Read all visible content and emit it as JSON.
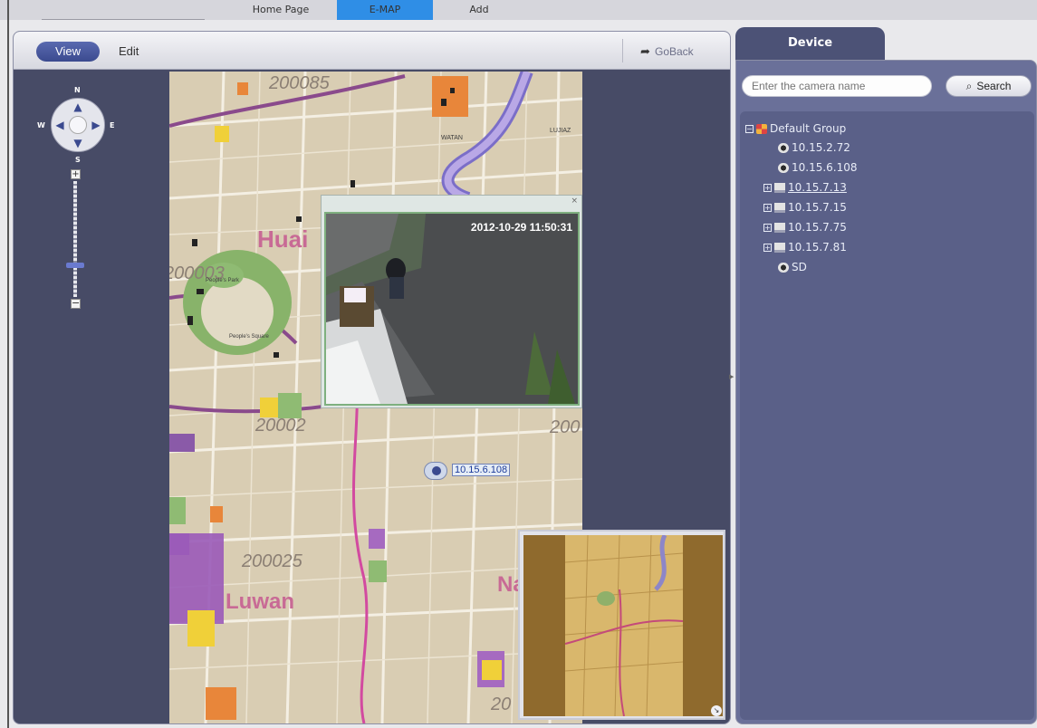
{
  "top_tabs": [
    {
      "label": "Home Page"
    },
    {
      "label": "E-MAP"
    },
    {
      "label": "Add"
    }
  ],
  "toolbar": {
    "view_label": "View",
    "edit_label": "Edit",
    "goback_label": "GoBack"
  },
  "compass": {
    "n": "N",
    "s": "S",
    "e": "E",
    "w": "W"
  },
  "zoom": {
    "plus": "+",
    "minus": "−",
    "level": 0.27
  },
  "map": {
    "labels": [
      {
        "text": "200085"
      },
      {
        "text": "200003"
      },
      {
        "text": "20002"
      },
      {
        "text": "200025"
      },
      {
        "text": "200"
      },
      {
        "text": "20"
      }
    ],
    "districts": [
      {
        "text": "Huai"
      },
      {
        "text": "Luwan"
      },
      {
        "text": "Na"
      }
    ],
    "small_labels": [
      "WATAN",
      "LUJIAZ",
      "People's Park",
      "People's Square"
    ]
  },
  "camera_popup": {
    "close": "×",
    "timestamp": "2012-10-29 11:50:31"
  },
  "marker": {
    "label": "10.15.6.108"
  },
  "minimap": {
    "resize": "↘"
  },
  "device_panel": {
    "tab_label": "Device",
    "search_placeholder": "Enter the camera name",
    "search_button": "Search",
    "tree": [
      {
        "label": "Default Group",
        "type": "group",
        "expander": "−"
      },
      {
        "label": "10.15.2.72",
        "type": "camera"
      },
      {
        "label": "10.15.6.108",
        "type": "camera"
      },
      {
        "label": "10.15.7.13",
        "type": "nvr",
        "expander": "+",
        "underlined": true
      },
      {
        "label": "10.15.7.15",
        "type": "nvr",
        "expander": "+"
      },
      {
        "label": "10.15.7.75",
        "type": "nvr",
        "expander": "+"
      },
      {
        "label": "10.15.7.81",
        "type": "nvr",
        "expander": "+"
      },
      {
        "label": "SD",
        "type": "camera"
      }
    ]
  },
  "colors": {
    "accent": "#2f8ee6",
    "panel_dark": "#474b66",
    "device_panel": "#6a7099",
    "marker_text": "#1c3b9a"
  }
}
